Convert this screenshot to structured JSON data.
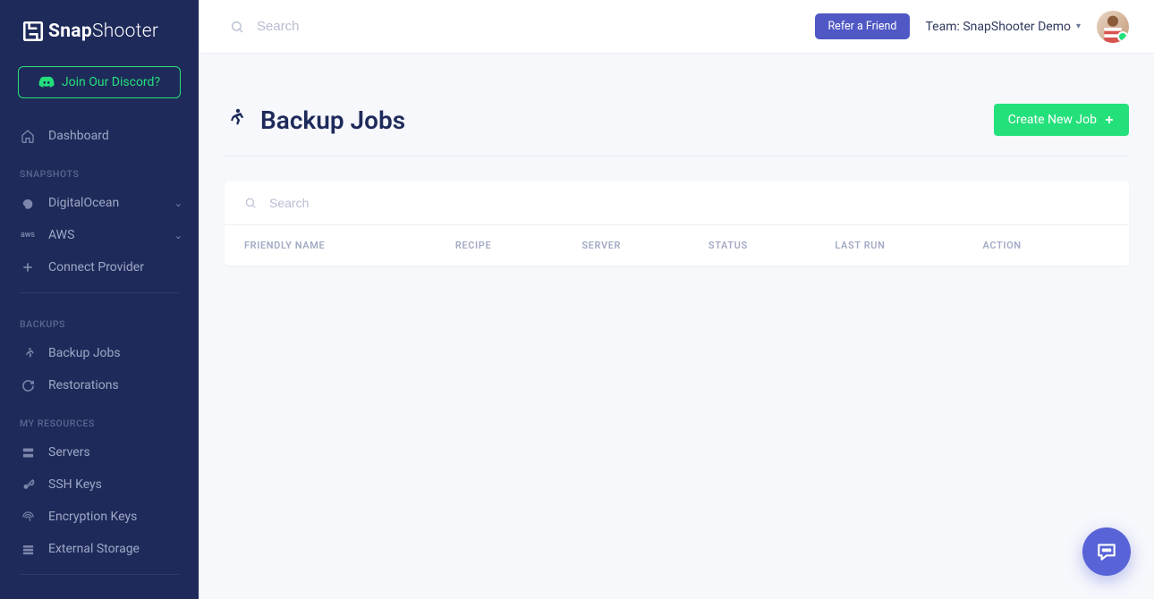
{
  "brand": {
    "bold": "Snap",
    "thin": "Shooter"
  },
  "sidebar": {
    "discord": "Join Our Discord?",
    "dashboard": "Dashboard",
    "sections": {
      "snapshots": "SNAPSHOTS",
      "backups": "BACKUPS",
      "resources": "MY RESOURCES"
    },
    "items": {
      "digitalocean": "DigitalOcean",
      "aws": "AWS",
      "connect_provider": "Connect Provider",
      "backup_jobs": "Backup Jobs",
      "restorations": "Restorations",
      "servers": "Servers",
      "ssh_keys": "SSH Keys",
      "encryption_keys": "Encryption Keys",
      "external_storage": "External Storage"
    }
  },
  "topbar": {
    "search_placeholder": "Search",
    "refer": "Refer a Friend",
    "team_label": "Team: SnapShooter Demo"
  },
  "page": {
    "title": "Backup Jobs",
    "create_button": "Create New Job",
    "table_search_placeholder": "Search",
    "columns": {
      "friendly_name": "FRIENDLY NAME",
      "recipe": "RECIPE",
      "server": "SERVER",
      "status": "STATUS",
      "last_run": "LAST RUN",
      "action": "ACTION"
    }
  },
  "colors": {
    "sidebar_bg": "#1e2a5a",
    "accent_green": "#24e07b",
    "accent_purple": "#4f58c4"
  }
}
